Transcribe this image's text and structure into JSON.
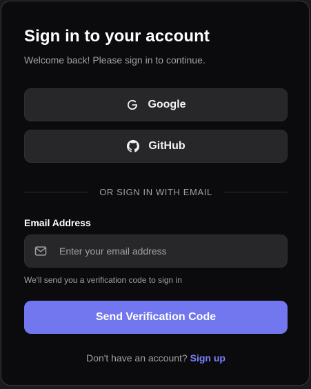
{
  "header": {
    "title": "Sign in to your account",
    "subtitle": "Welcome back! Please sign in to continue."
  },
  "oauth": [
    {
      "label": "Google",
      "icon": "google-icon"
    },
    {
      "label": "GitHub",
      "icon": "github-icon"
    }
  ],
  "divider": {
    "text": "OR SIGN IN WITH EMAIL"
  },
  "email": {
    "label": "Email Address",
    "placeholder": "Enter your email address",
    "value": "",
    "icon": "mail-icon",
    "hint": "We'll send you a verification code to sign in"
  },
  "submit": {
    "label": "Send Verification Code"
  },
  "footer": {
    "prompt": "Don't have an account?",
    "link": "Sign up"
  },
  "colors": {
    "background": "#0b0b0d",
    "button": "#27272a",
    "accent": "#7276ef",
    "link": "#7b80ff",
    "muted_text": "#a1a1a6"
  }
}
